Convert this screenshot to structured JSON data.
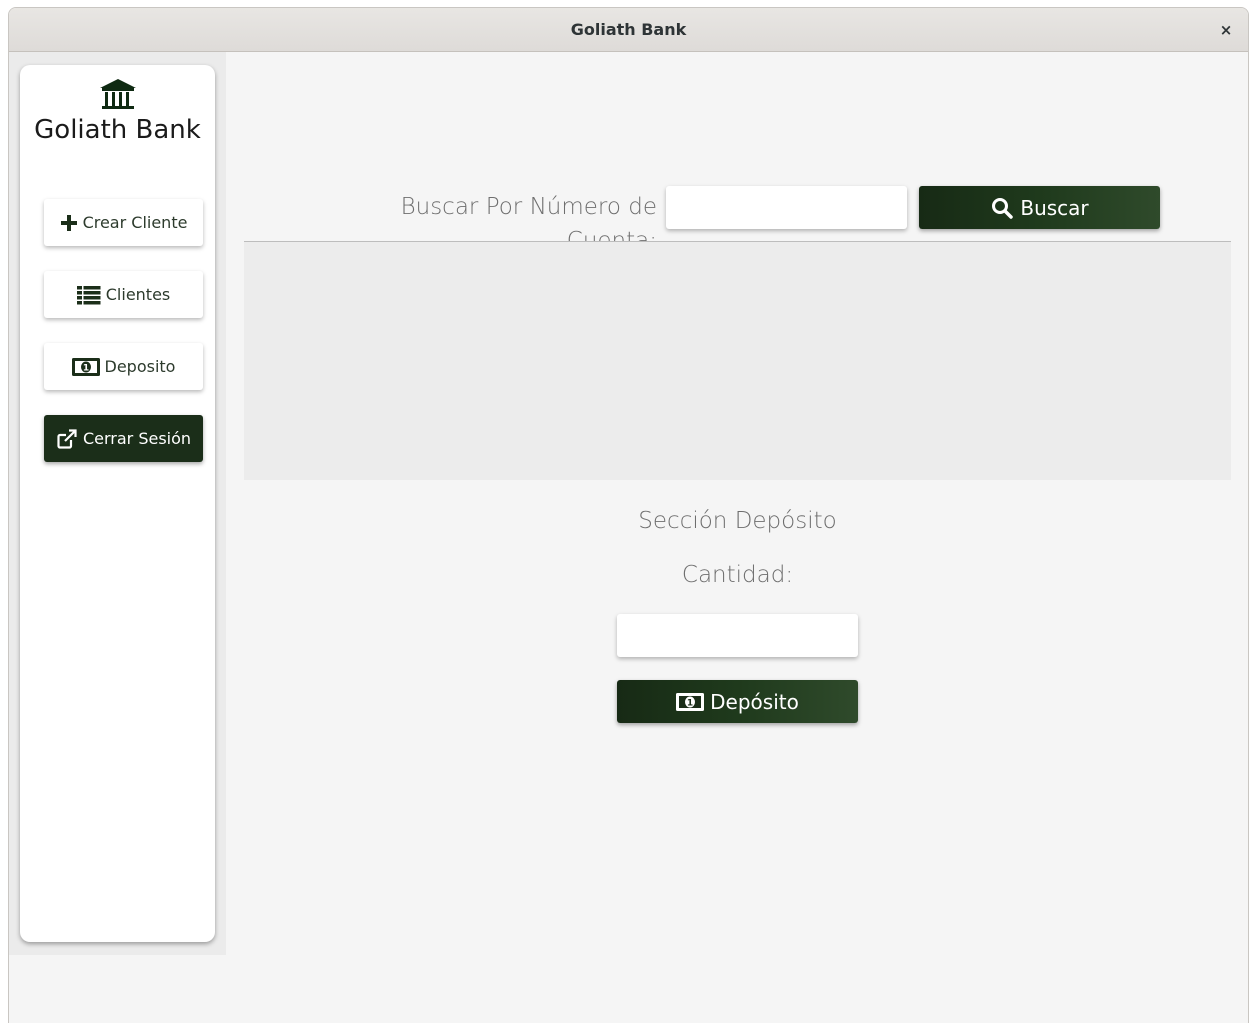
{
  "window": {
    "title": "Goliath Bank",
    "close_symbol": "×"
  },
  "sidebar": {
    "logo_icon": "bank-icon",
    "brand": "Goliath Bank",
    "items": [
      {
        "label": "Crear Cliente",
        "icon": "plus-icon"
      },
      {
        "label": "Clientes",
        "icon": "list-icon"
      },
      {
        "label": "Deposito",
        "icon": "money-bill-icon"
      },
      {
        "label": "Cerrar Sesión",
        "icon": "external-link-icon"
      }
    ]
  },
  "search": {
    "label": "Buscar Por Número de Cuenta:",
    "value": "",
    "button_label": "Buscar",
    "button_icon": "search-icon"
  },
  "deposit": {
    "section_title": "Sección Depósito",
    "amount_label": "Cantidad:",
    "amount_value": "",
    "button_label": "Depósito",
    "button_icon": "money-bill-icon"
  },
  "colors": {
    "primary": "#1b2e19",
    "window_bg": "#f5f5f5",
    "result_area": "#ececec"
  }
}
